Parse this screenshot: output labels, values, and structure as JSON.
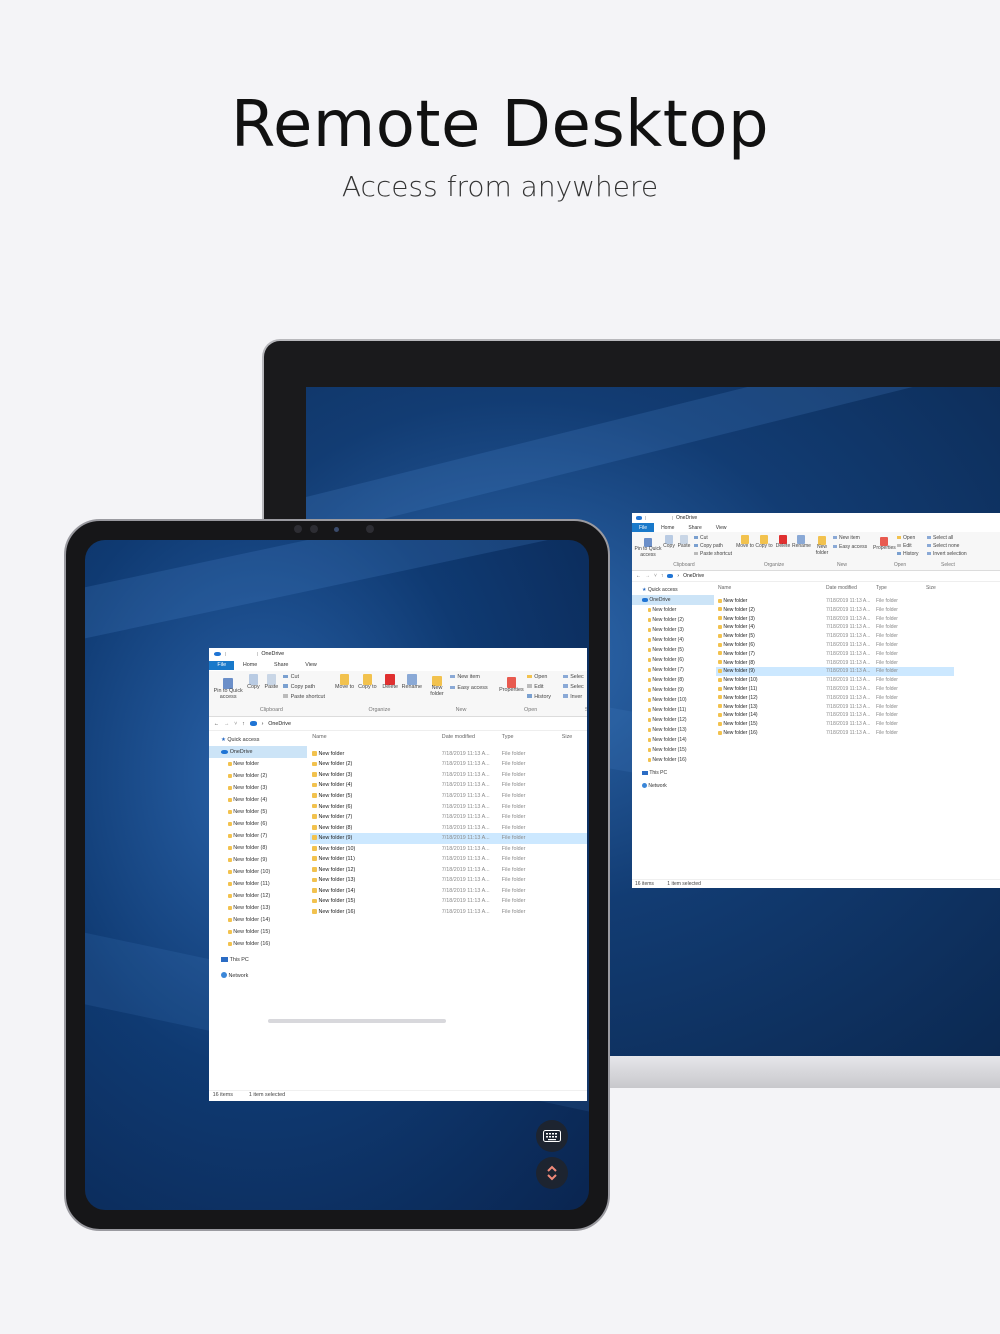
{
  "headline": {
    "title": "Remote Desktop",
    "subtitle": "Access from anywhere"
  },
  "colors": {
    "background": "#f4f4f7",
    "desktop_blue": "#123c73",
    "ribbon_file_tab": "#1979ca",
    "selection": "#cce8ff",
    "folder": "#f2c24e"
  },
  "explorer": {
    "window_title": "OneDrive",
    "tabs": [
      "File",
      "Home",
      "Share",
      "View"
    ],
    "ribbon": {
      "pin_label": "Pin to Quick access",
      "copy_label": "Copy",
      "paste_label": "Paste",
      "cut_label": "Cut",
      "copy_path_label": "Copy path",
      "paste_shortcut_label": "Paste shortcut",
      "move_to_label": "Move to",
      "copy_to_label": "Copy to",
      "delete_label": "Delete",
      "rename_label": "Rename",
      "new_folder_label": "New folder",
      "new_item_label": "New item",
      "easy_access_label": "Easy access",
      "properties_label": "Properties",
      "open_label": "Open",
      "edit_label": "Edit",
      "history_label": "History",
      "select_all_label": "Select all",
      "select_none_label": "Select none",
      "invert_selection_label": "Invert selection",
      "select_all_label_tablet": "Selec",
      "select_none_label_tablet": "Selec",
      "invert_selection_label_tablet": "Inver",
      "group_clipboard": "Clipboard",
      "group_organize": "Organize",
      "group_new": "New",
      "group_open": "Open",
      "group_select": "Select",
      "group_select_tablet": "Se"
    },
    "address": "OneDrive",
    "nav": {
      "quick_access": "Quick access",
      "onedrive": "OneDrive",
      "this_pc": "This PC",
      "network": "Network"
    },
    "columns": {
      "name": "Name",
      "date_modified": "Date modified",
      "type": "Type",
      "size": "Size"
    },
    "folders": [
      "New folder",
      "New folder (2)",
      "New folder (3)",
      "New folder (4)",
      "New folder (5)",
      "New folder (6)",
      "New folder (7)",
      "New folder (8)",
      "New folder (9)",
      "New folder (10)",
      "New folder (11)",
      "New folder (12)",
      "New folder (13)",
      "New folder (14)",
      "New folder (15)",
      "New folder (16)"
    ],
    "date_value": "7/18/2019 11:13 A...",
    "type_value": "File folder",
    "selected_index": 8,
    "status_items": "16 items",
    "status_selected": "1 item selected"
  },
  "controls": {
    "keyboard_icon": "keyboard-icon",
    "expand_icon": "chevron-up-down-icon"
  }
}
